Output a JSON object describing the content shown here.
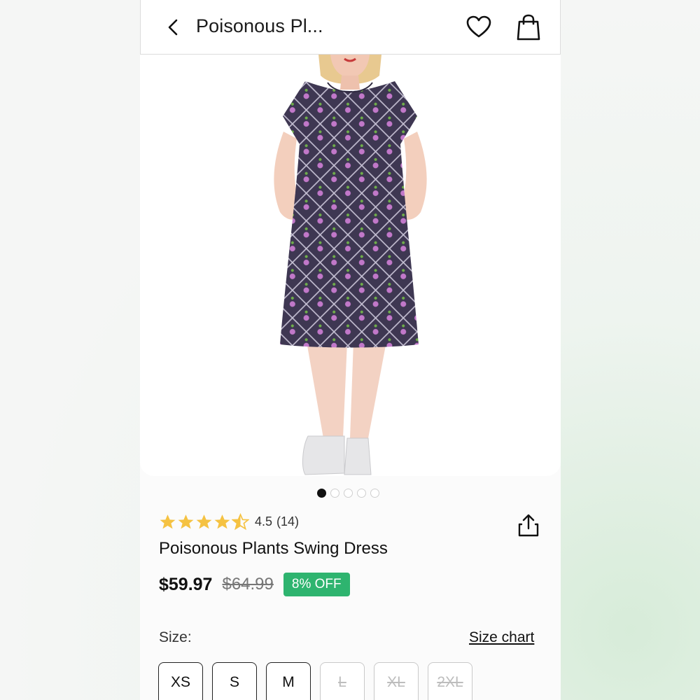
{
  "header": {
    "title": "Poisonous Pl...",
    "back_icon": "chevron-left-icon",
    "wishlist_icon": "heart-icon",
    "cart_icon": "shopping-bag-icon"
  },
  "gallery": {
    "image_count": 5,
    "active_index": 0
  },
  "product": {
    "rating": 4.5,
    "rating_text": "4.5",
    "review_count_text": "(14)",
    "star_color": "#f5c242",
    "name": "Poisonous Plants Swing Dress",
    "price": "$59.97",
    "original_price": "$64.99",
    "discount_badge": "8% OFF",
    "discount_color": "#2eb46f",
    "share_icon": "share-icon"
  },
  "size": {
    "label": "Size:",
    "chart_link": "Size chart",
    "options": [
      {
        "label": "XS",
        "available": true
      },
      {
        "label": "S",
        "available": true
      },
      {
        "label": "M",
        "available": true
      },
      {
        "label": "L",
        "available": false
      },
      {
        "label": "XL",
        "available": false
      },
      {
        "label": "2XL",
        "available": false
      }
    ]
  }
}
